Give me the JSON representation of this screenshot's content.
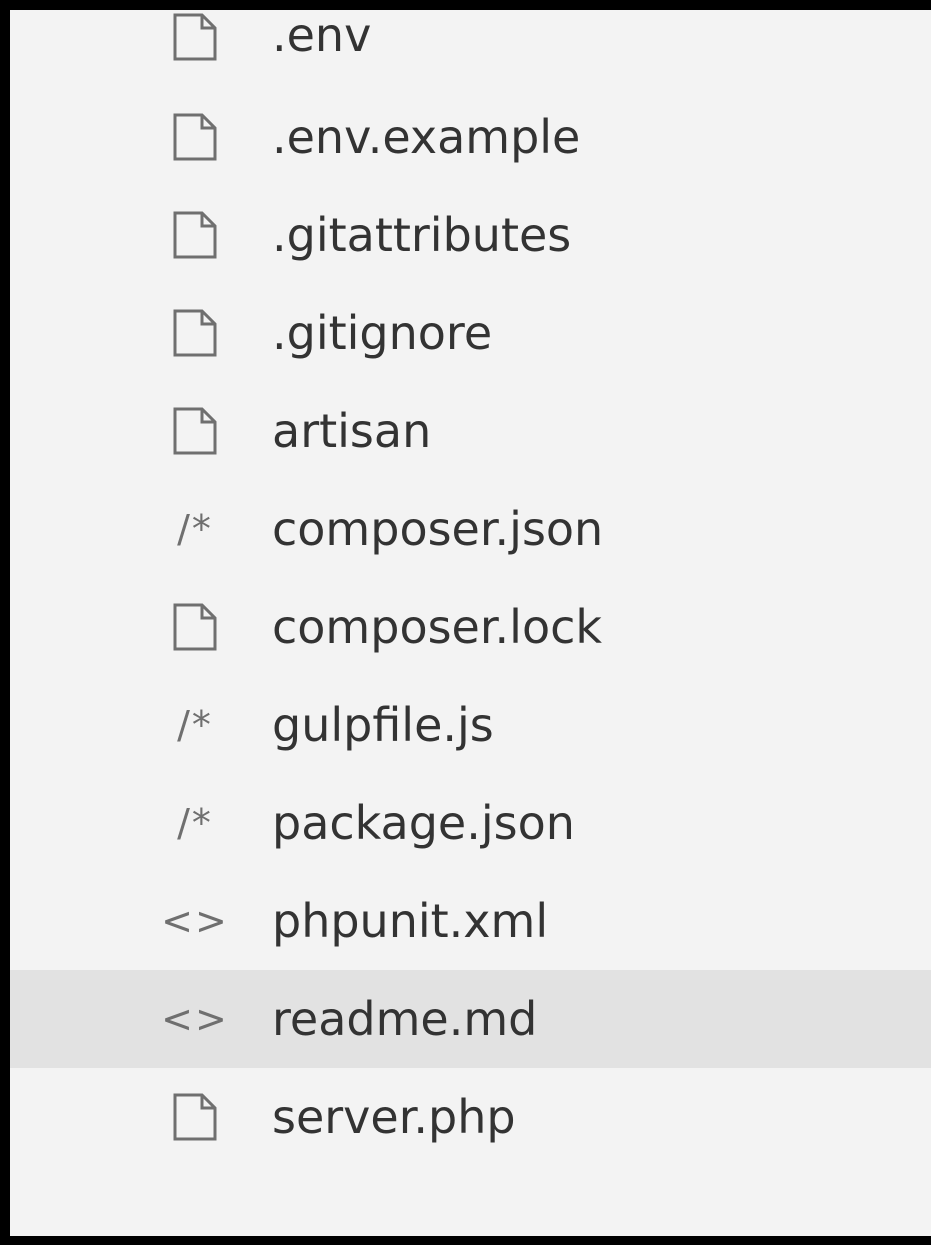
{
  "explorer": {
    "files": [
      {
        "name": ".env",
        "icon": "file-icon"
      },
      {
        "name": ".env.example",
        "icon": "file-icon"
      },
      {
        "name": ".gitattributes",
        "icon": "file-icon"
      },
      {
        "name": ".gitignore",
        "icon": "file-icon"
      },
      {
        "name": "artisan",
        "icon": "file-icon"
      },
      {
        "name": "composer.json",
        "icon": "json-icon"
      },
      {
        "name": "composer.lock",
        "icon": "file-icon"
      },
      {
        "name": "gulpfile.js",
        "icon": "js-icon"
      },
      {
        "name": "package.json",
        "icon": "json-icon"
      },
      {
        "name": "phpunit.xml",
        "icon": "markup-icon"
      },
      {
        "name": "readme.md",
        "icon": "markup-icon"
      },
      {
        "name": "server.php",
        "icon": "file-icon"
      }
    ],
    "selected_index": 10
  },
  "glyphs": {
    "comment": "/*",
    "markup": "<>"
  },
  "colors": {
    "panel_background": "#f3f3f3",
    "selected_row": "#e2e2e2",
    "icon": "#6f6f6f",
    "text": "#333333",
    "border": "#000000"
  }
}
